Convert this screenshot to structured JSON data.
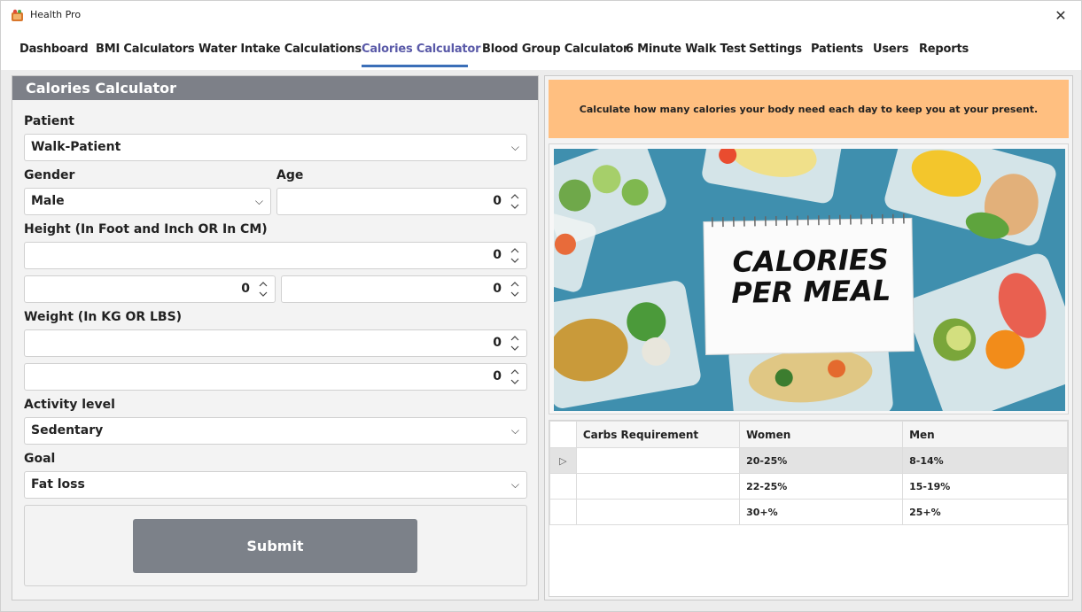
{
  "window": {
    "title": "Health Pro"
  },
  "tabs": [
    {
      "label": "Dashboard"
    },
    {
      "label": "BMI Calculators"
    },
    {
      "label": "Water Intake Calculations"
    },
    {
      "label": "Calories Calculator"
    },
    {
      "label": "Blood Group Calculator"
    },
    {
      "label": "6 Minute Walk Test"
    },
    {
      "label": "Settings"
    },
    {
      "label": "Patients"
    },
    {
      "label": "Users"
    },
    {
      "label": "Reports"
    }
  ],
  "active_tab": "Calories Calculator",
  "form": {
    "header": "Calories Calculator",
    "patient_label": "Patient",
    "patient_value": "Walk-Patient",
    "gender_label": "Gender",
    "gender_value": "Male",
    "age_label": "Age",
    "age_value": "0",
    "height_label": "Height (In Foot and Inch OR In CM)",
    "height_cm_value": "0",
    "height_foot_value": "0",
    "height_inch_value": "0",
    "weight_label": "Weight (In KG OR LBS)",
    "weight_kg_value": "0",
    "weight_lbs_value": "0",
    "activity_label": "Activity level",
    "activity_value": "Sedentary",
    "goal_label": "Goal",
    "goal_value": "Fat loss",
    "submit_label": "Submit"
  },
  "info": {
    "text": "Calculate how many calories your body need each day to keep you at your present."
  },
  "banner": {
    "line1": "CALORIES",
    "line2": "PER  MEAL"
  },
  "grid": {
    "columns": [
      "Carbs Requirement",
      "Women",
      "Men"
    ],
    "rows": [
      {
        "marker": "▷",
        "carbs": "",
        "women": "20-25%",
        "men": "8-14%"
      },
      {
        "marker": "",
        "carbs": "",
        "women": "22-25%",
        "men": "15-19%"
      },
      {
        "marker": "",
        "carbs": "",
        "women": "30+%",
        "men": "25+%"
      }
    ]
  },
  "colors": {
    "header_bg": "#7d8088",
    "info_bg": "#ffbf80",
    "active_tab": "#5a5aa8",
    "tab_underline": "#3b6fb8",
    "submit_bg": "#7c8189"
  }
}
